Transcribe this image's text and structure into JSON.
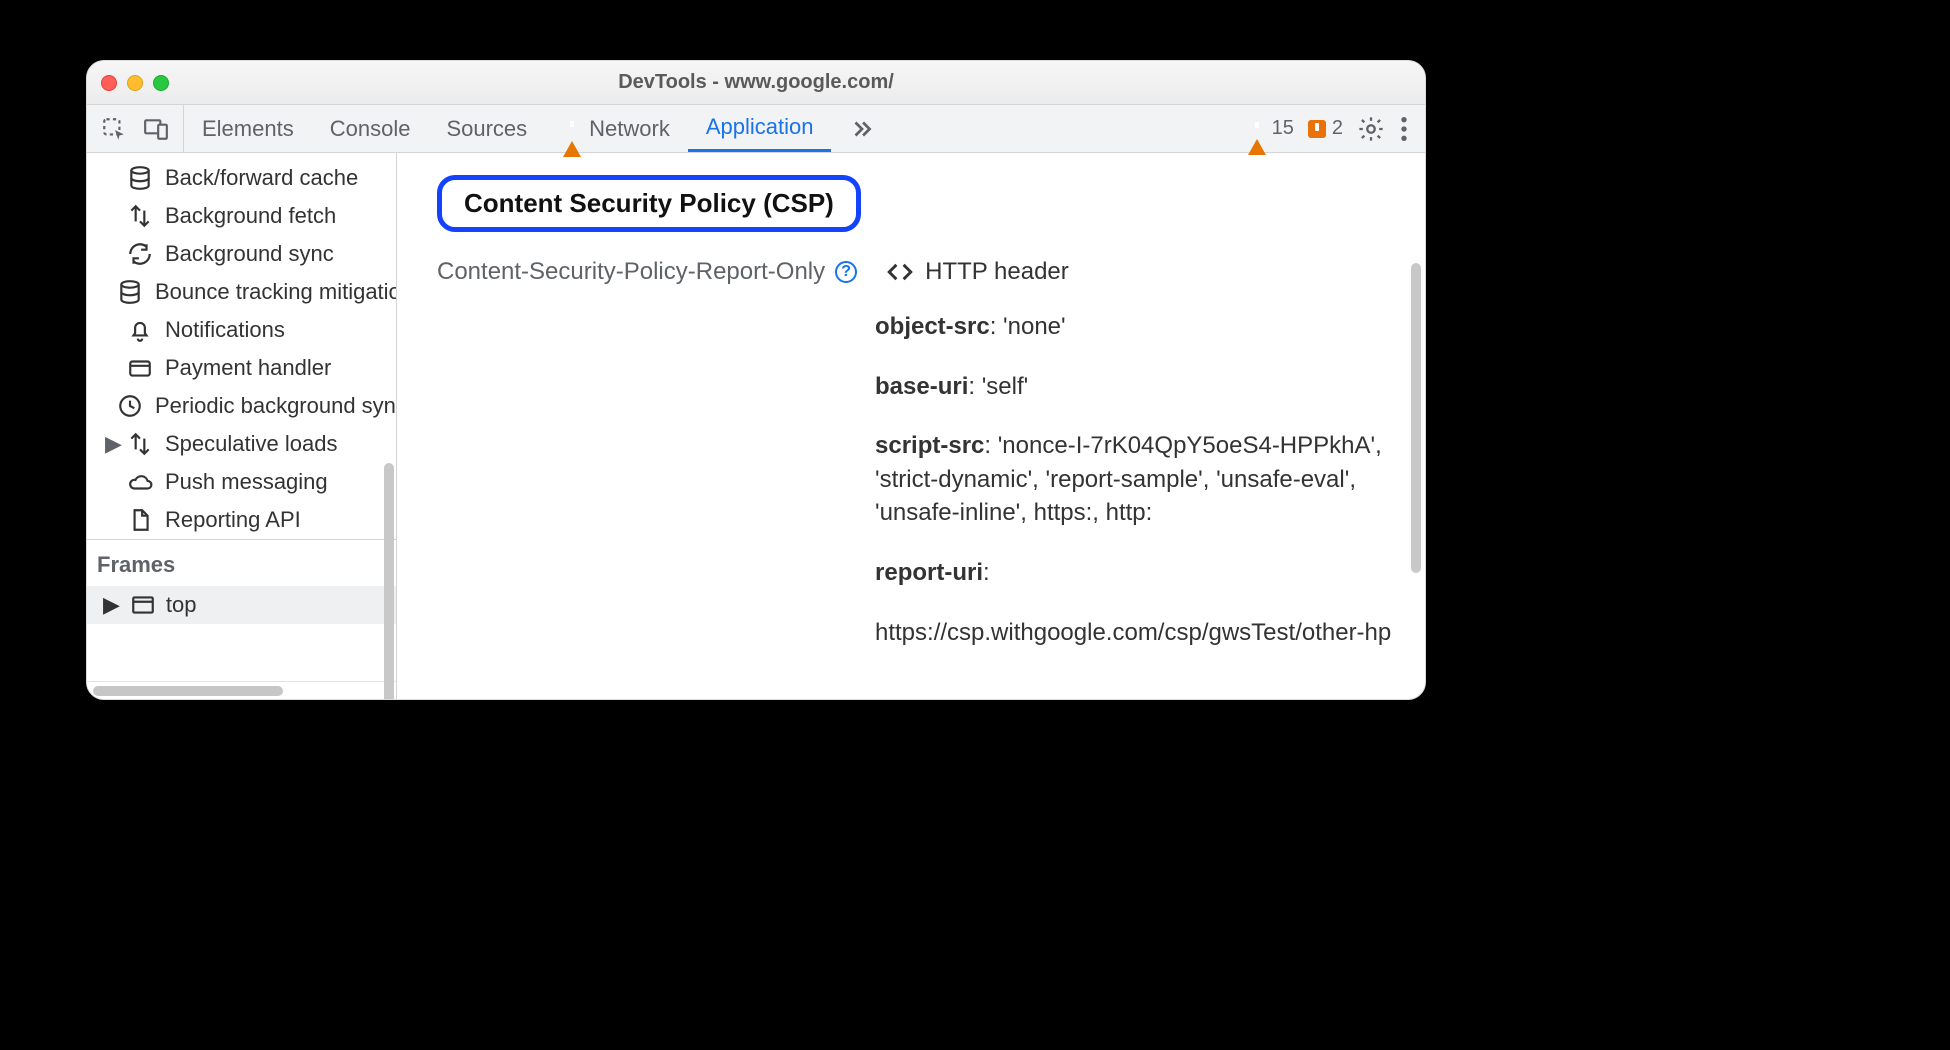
{
  "window": {
    "title": "DevTools - www.google.com/"
  },
  "tabs": {
    "items": [
      "Elements",
      "Console",
      "Sources",
      "Network",
      "Application"
    ],
    "active_index": 4,
    "network_has_warning": true
  },
  "warnings": {
    "count": "15"
  },
  "issues": {
    "count": "2"
  },
  "sidebar": {
    "items": [
      {
        "icon": "database",
        "label": "Back/forward cache"
      },
      {
        "icon": "updown",
        "label": "Background fetch"
      },
      {
        "icon": "sync",
        "label": "Background sync"
      },
      {
        "icon": "database",
        "label": "Bounce tracking mitigation"
      },
      {
        "icon": "bell",
        "label": "Notifications"
      },
      {
        "icon": "card",
        "label": "Payment handler"
      },
      {
        "icon": "clock",
        "label": "Periodic background sync"
      },
      {
        "icon": "updown",
        "label": "Speculative loads",
        "expandable": true
      },
      {
        "icon": "cloud",
        "label": "Push messaging"
      },
      {
        "icon": "file",
        "label": "Reporting API"
      }
    ],
    "frames_header": "Frames",
    "frame_top": "top"
  },
  "content": {
    "heading": "Content Security Policy (CSP)",
    "report_only_label": "Content-Security-Policy-Report-Only",
    "http_header_label": "HTTP header",
    "rules": [
      {
        "name": "object-src",
        "value": "'none'"
      },
      {
        "name": "base-uri",
        "value": "'self'"
      },
      {
        "name": "script-src",
        "value": "'nonce-I-7rK04QpY5oeS4-HPPkhA', 'strict-dynamic', 'report-sample', 'unsafe-eval', 'unsafe-inline', https:, http:"
      },
      {
        "name": "report-uri",
        "value": "https://csp.withgoogle.com/csp/gwsTest/other-hp"
      }
    ]
  }
}
